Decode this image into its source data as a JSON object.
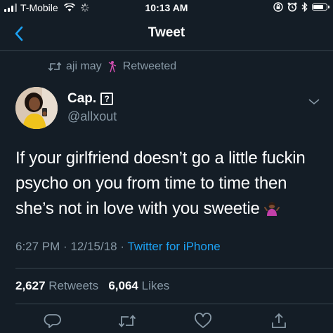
{
  "status_bar": {
    "carrier": "T-Mobile",
    "time": "10:13 AM",
    "battery_level": 0.85
  },
  "nav": {
    "title": "Tweet"
  },
  "retweet": {
    "retweeter": "aji may",
    "label": "Retweeted"
  },
  "author": {
    "display_name": "Cap.",
    "badge": "?",
    "handle": "@allxout"
  },
  "tweet": {
    "text": "If your girlfriend doesn’t go a little fuckin psycho on you from time to time then she’s not in love with you sweetie"
  },
  "meta": {
    "time": "6:27 PM",
    "date": "12/15/18",
    "separator": "·",
    "source": "Twitter for iPhone"
  },
  "stats": {
    "retweets_count": "2,627",
    "retweets_label": "Retweets",
    "likes_count": "6,064",
    "likes_label": "Likes"
  },
  "colors": {
    "background": "#141d26",
    "accent": "#1da1f2",
    "secondary_text": "#8899a6",
    "divider": "#38444d"
  },
  "icons": {
    "back": "chevron-left-icon",
    "retweet": "retweet-icon",
    "caret": "chevron-down-icon",
    "reply": "reply-icon",
    "like": "heart-icon",
    "share": "share-icon"
  }
}
